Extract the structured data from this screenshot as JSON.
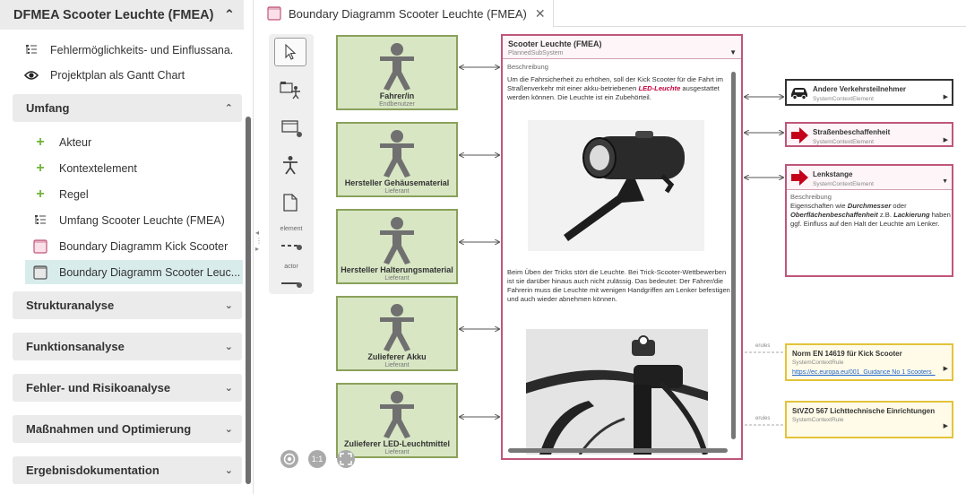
{
  "project": {
    "title": "DFMEA Scooter Leuchte (FMEA)"
  },
  "top_items": [
    {
      "label": "Fehlermöglichkeits- und Einflussana...",
      "icon": "list-tree-icon"
    },
    {
      "label": "Projektplan als Gantt Chart",
      "icon": "eye-icon"
    }
  ],
  "umfang": {
    "title": "Umfang",
    "items": [
      {
        "label": "Akteur",
        "icon": "plus-icon"
      },
      {
        "label": "Kontextelement",
        "icon": "plus-icon"
      },
      {
        "label": "Regel",
        "icon": "plus-icon"
      },
      {
        "label": "Umfang Scooter Leuchte (FMEA)",
        "icon": "list-tree-icon"
      },
      {
        "label": "Boundary Diagramm Kick Scooter",
        "icon": "diagram-pink-icon"
      },
      {
        "label": "Boundary Diagramm Scooter Leuc...",
        "icon": "diagram-grey-icon"
      }
    ]
  },
  "sections": [
    {
      "title": "Strukturanalyse"
    },
    {
      "title": "Funktionsanalyse"
    },
    {
      "title": "Fehler- und Risikoanalyse"
    },
    {
      "title": "Maßnahmen und Optimierung"
    },
    {
      "title": "Ergebnisdokumentation"
    }
  ],
  "tab": {
    "label": "Boundary Diagramm Scooter Leuchte (FMEA)",
    "close": "✕"
  },
  "toolbox": {
    "element_label": "element",
    "actor_label": "actor"
  },
  "actors": [
    {
      "name": "Fahrer/in",
      "role": "Endbenutzer"
    },
    {
      "name": "Hersteller Gehäusematerial",
      "role": "Lieferant"
    },
    {
      "name": "Hersteller Halterungsmaterial",
      "role": "Lieferant"
    },
    {
      "name": "Zulieferer Akku",
      "role": "Lieferant"
    },
    {
      "name": "Zulieferer LED-Leuchtmittel",
      "role": "Lieferant"
    }
  ],
  "subsystem": {
    "title": "Scooter Leuchte (FMEA)",
    "type": "PlannedSubSystem",
    "desc_label": "Beschreibung",
    "text1_a": "Um die Fahrsicherheit zu erhöhen, soll der Kick Scooter für die Fahrt im Straßenverkehr mit einer akku-betriebenen ",
    "text1_em": "LED-Leuchte",
    "text1_b": " ausgestattet werden können. Die Leuchte ist ein Zubehörteil.",
    "text2": "Beim Üben der Tricks stört die Leuchte. Bei Trick-Scooter-Wettbewerben ist sie darüber hinaus auch nicht zulässig. Das bedeutet: Der Fahrer/die Fahrerin muss die Leuchte mit wenigen Handgriffen am Lenker befestigen und auch wieder abnehmen können."
  },
  "context_elements": [
    {
      "title": "Andere Verkehrsteilnehmer",
      "type": "SystemContextElement",
      "icon": "car-icon"
    },
    {
      "title": "Straßenbeschaffenheit",
      "type": "SystemContextElement",
      "icon": "red-arrow-icon"
    },
    {
      "title": "Lenkstange",
      "type": "SystemContextElement",
      "icon": "red-arrow-icon",
      "desc_label": "Beschreibung",
      "desc_a": "Eigenschaften wie ",
      "desc_em1": "Durchmesser",
      "desc_b": " oder ",
      "desc_em2": "Oberflächenbeschaffenheit",
      "desc_c": " z.B. ",
      "desc_em3": "Lackierung",
      "desc_d": " haben ggf. Einfluss auf den Halt der Leuchte am Lenker."
    }
  ],
  "rules": [
    {
      "title": "Norm EN 14619 für Kick Scooter",
      "type": "SystemContextRule",
      "link": "https://ec.europa.eu/001_Guidance No 1 Scooters_",
      "edge": "erules"
    },
    {
      "title": "StVZO 567 Lichttechnische Einrichtungen",
      "type": "SystemContextRule",
      "edge": "erules"
    }
  ],
  "controls": {
    "fit": "1:1"
  },
  "colors": {
    "actor_fill": "#d8e6c4",
    "actor_border": "#8aa15b",
    "context_border": "#c0567a",
    "rule_border": "#e3c33b",
    "selected_bg": "#d9ecec"
  }
}
